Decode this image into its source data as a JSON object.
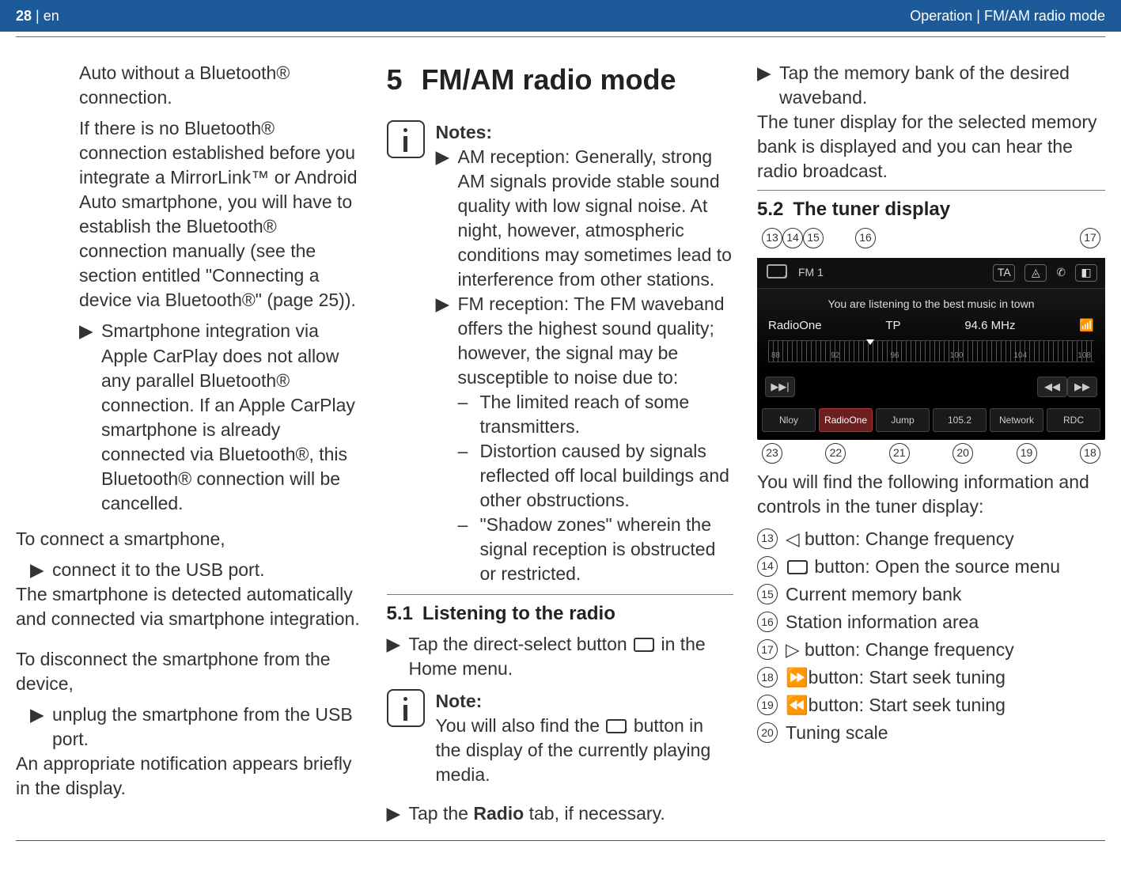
{
  "header": {
    "page_number": "28",
    "lang_sep": " | ",
    "lang": "en",
    "breadcrumb": "Operation | FM/AM radio mode"
  },
  "col1": {
    "p1": "Auto without a Bluetooth® connection.",
    "p2": "If there is no Bluetooth® connection established before you integrate a MirrorLink™ or Android Auto smartphone, you will have to establish the Bluetooth® connection manually (see the section entitled \"Connecting a device via Bluetooth®\" (page 25)).",
    "b1": "Smartphone integration via Apple CarPlay does not allow any parallel Bluetooth® connection. If an Apple CarPlay smartphone is already connected via Bluetooth®, this Bluetooth® connection will be cancelled.",
    "p3": "To connect a smartphone,",
    "b2": "connect it to the USB port.",
    "p4": "The smartphone is detected automatically and connected via smartphone integration.",
    "p5": "To disconnect the smartphone from the device,",
    "b3": "unplug the smartphone from the USB port.",
    "p6": "An appropriate notification appears briefly in the display."
  },
  "col2": {
    "h1_num": "5",
    "h1": "FM/AM radio mode",
    "notes_title": "Notes:",
    "n1": "AM reception: Generally, strong AM signals provide stable sound quality with low signal noise. At night, however, atmospheric conditions may sometimes lead to interference from other stations.",
    "n2": "FM reception: The FM waveband offers the highest sound quality; however, the signal may be susceptible to noise due to:",
    "n2a": "The limited reach of some transmitters.",
    "n2b": "Distortion caused by signals reflected off local buildings and other obstructions.",
    "n2c": "\"Shadow zones\" wherein the signal reception is obstructed or restricted.",
    "s51_num": "5.1",
    "s51_title": "Listening to the radio",
    "s51_b1a": "Tap the direct-select button ",
    "s51_b1b": " in the Home menu.",
    "note2_title": "Note:",
    "note2a": "You will also find the ",
    "note2b": " button in the display of the currently playing media.",
    "s51_b2a": "Tap the ",
    "s51_b2_bold": "Radio",
    "s51_b2b": " tab, if necessary."
  },
  "col3": {
    "b1": "Tap the memory bank of the desired waveband.",
    "p1": "The tuner display for the selected memory bank is displayed and you can hear the radio broadcast.",
    "s52_num": "5.2",
    "s52_title": "The tuner display",
    "p2": "You will find the following information and controls in the tuner display:",
    "legend": [
      {
        "n": "13",
        "g": "◁",
        "t": "button: Change frequency"
      },
      {
        "n": "14",
        "g": "radio",
        "t": "button: Open the source menu"
      },
      {
        "n": "15",
        "g": "",
        "t": "Current memory bank"
      },
      {
        "n": "16",
        "g": "",
        "t": "Station information area"
      },
      {
        "n": "17",
        "g": "▷",
        "t": "button: Change frequency"
      },
      {
        "n": "18",
        "g": "⏩",
        "t": "button: Start seek tuning"
      },
      {
        "n": "19",
        "g": "⏪",
        "t": "button: Start seek tuning"
      },
      {
        "n": "20",
        "g": "",
        "t": "Tuning scale"
      }
    ]
  },
  "tuner": {
    "callouts_top": [
      "13",
      "14",
      "15",
      "16",
      "17"
    ],
    "callouts_bottom": [
      "23",
      "22",
      "21",
      "20",
      "19",
      "18"
    ],
    "band": "FM 1",
    "ta_icon": "TA",
    "slogan": "You are listening to the best music in town",
    "station": "RadioOne",
    "tp": "TP",
    "freq": "94.6 MHz",
    "scale": [
      "88",
      "92",
      "96",
      "100",
      "104",
      "108"
    ],
    "scan": "⏯",
    "back": "⏮",
    "fwd": "⏭",
    "presets": [
      {
        "label": "Nloy",
        "active": false
      },
      {
        "label": "RadioOne",
        "active": true
      },
      {
        "label": "Jump",
        "active": false
      },
      {
        "label": "105.2",
        "active": false
      },
      {
        "label": "Network",
        "active": false
      },
      {
        "label": "RDC",
        "active": false
      }
    ]
  }
}
